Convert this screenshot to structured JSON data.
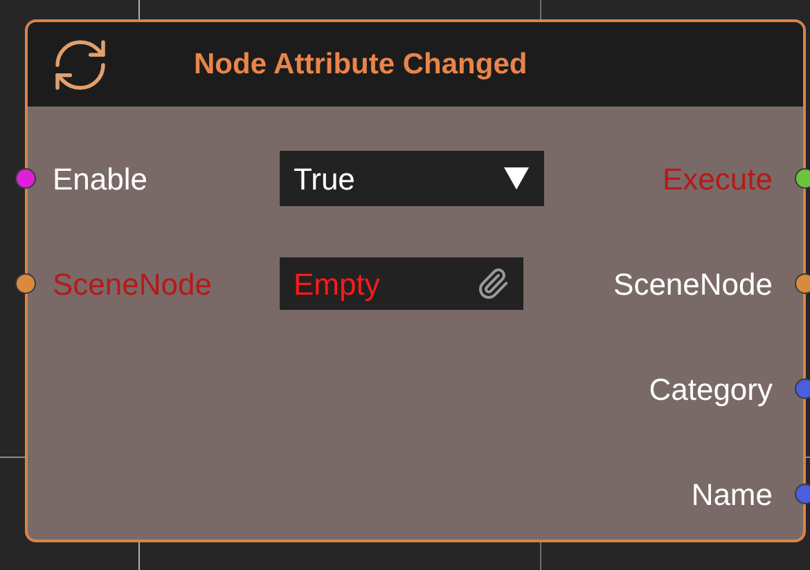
{
  "node": {
    "title": "Node Attribute Changed",
    "inputs": [
      {
        "label": "Enable",
        "color": "#e020d8",
        "invalid": false,
        "field": {
          "kind": "dropdown",
          "value": "True",
          "invalid": false
        }
      },
      {
        "label": "SceneNode",
        "color": "#d98a3c",
        "invalid": true,
        "field": {
          "kind": "object",
          "value": "Empty",
          "invalid": true
        }
      }
    ],
    "outputs": [
      {
        "label": "Execute",
        "color": "#6cc43c",
        "invalid": true
      },
      {
        "label": "SceneNode",
        "color": "#d98a3c",
        "invalid": false
      },
      {
        "label": "Category",
        "color": "#4a5ee0",
        "invalid": false
      },
      {
        "label": "Name",
        "color": "#4a5ee0",
        "invalid": false
      }
    ]
  }
}
